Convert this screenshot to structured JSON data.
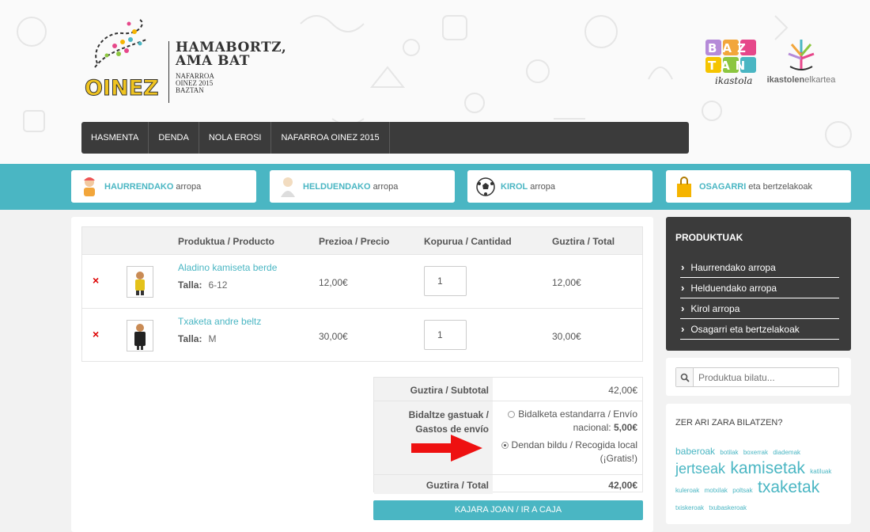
{
  "brand": {
    "title_l1": "HAMABORTZ,",
    "title_l2": "AMA BAT",
    "sub_l1": "NAFARROA",
    "sub_l2": "OINEZ 2015",
    "sub_l3": "BAZTAN"
  },
  "logos": {
    "oinez": "OINEZ",
    "baztan_l1": "BAZ",
    "baztan_l2": "TAN",
    "baztan_sub": "ikastola",
    "elkartea_b": "ikastolen",
    "elkartea_n": "elkartea"
  },
  "nav": [
    "HASMENTA",
    "DENDA",
    "NOLA EROSI",
    "NAFARROA OINEZ 2015"
  ],
  "categories": [
    {
      "bold": "HAURRENDAKO",
      "rest": "arropa",
      "icon": "child-icon"
    },
    {
      "bold": "HELDUENDAKO",
      "rest": "arropa",
      "icon": "adult-icon"
    },
    {
      "bold": "KIROL",
      "rest": "arropa",
      "icon": "soccer-ball-icon"
    },
    {
      "bold": "OSAGARRI",
      "rest": "eta bertzelakoak",
      "icon": "shopping-bag-icon"
    }
  ],
  "cart": {
    "headers": {
      "product": "Produktua / Producto",
      "price": "Prezioa / Precio",
      "qty": "Kopurua / Cantidad",
      "total": "Guztira / Total"
    },
    "talla_label": "Talla:",
    "remove_symbol": "×",
    "items": [
      {
        "name": "Aladino kamiseta berde",
        "talla": "6-12",
        "price": "12,00€",
        "qty": "1",
        "total": "12,00€"
      },
      {
        "name": "Txaketa andre beltz",
        "talla": "M",
        "price": "30,00€",
        "qty": "1",
        "total": "30,00€"
      }
    ]
  },
  "summary": {
    "subtotal_label": "Guztira / Subtotal",
    "subtotal": "42,00€",
    "shipping_label_l1": "Bidaltze gastuak /",
    "shipping_label_l2": "Gastos de envío",
    "opt1_l1": "Bidalketa estandarra / Envío",
    "opt1_l2": "nacional:",
    "opt1_price": "5,00€",
    "opt2_l1": "Dendan bildu / Recogida local",
    "opt2_l2": "(¡Gratis!)",
    "total_label": "Guztira / Total",
    "total": "42,00€",
    "checkout": "KAJARA JOAN / IR A CAJA"
  },
  "sidebar": {
    "title": "PRODUKTUAK",
    "items": [
      "Haurrendako arropa",
      "Helduendako arropa",
      "Kirol arropa",
      "Osagarri eta bertzelakoak"
    ]
  },
  "search": {
    "placeholder": "Produktua bilatu..."
  },
  "tags": {
    "title": "ZER ARI ZARA BILATZEN?",
    "items": [
      {
        "t": "baberoak",
        "s": "md"
      },
      {
        "t": "botilak",
        "s": "sm"
      },
      {
        "t": "boxerrak",
        "s": "sm"
      },
      {
        "t": "diademak",
        "s": "sm"
      },
      {
        "t": "jertseak",
        "s": "lg"
      },
      {
        "t": "kamisetak",
        "s": "xl"
      },
      {
        "t": "katiluak",
        "s": "sm"
      },
      {
        "t": "kuleroak",
        "s": "sm"
      },
      {
        "t": "motxilak",
        "s": "sm"
      },
      {
        "t": "poltsak",
        "s": "sm"
      },
      {
        "t": "txaketak",
        "s": "xl"
      },
      {
        "t": "txiskeroak",
        "s": "sm"
      },
      {
        "t": "txubaskeroak",
        "s": "sm"
      }
    ]
  },
  "colors": {
    "accent": "#4ab6c3",
    "dark": "#3b3b3b",
    "remove": "#dd0000",
    "arrow": "#ee1111"
  }
}
